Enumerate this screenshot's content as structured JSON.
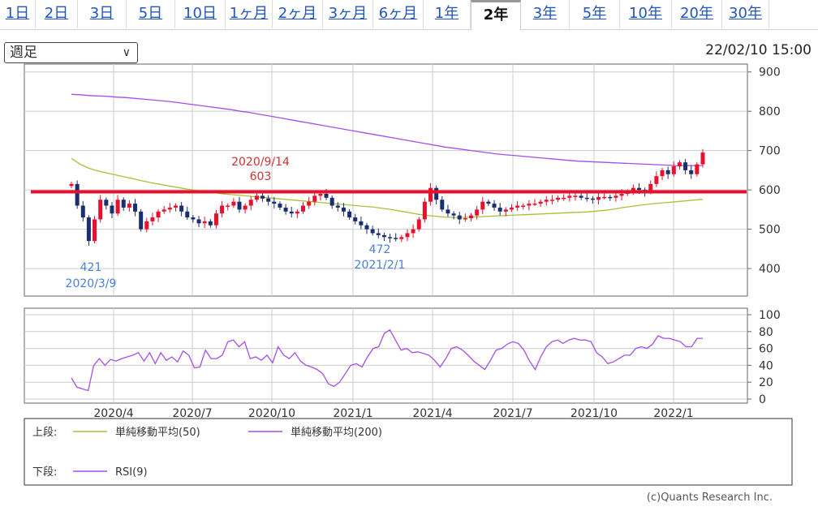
{
  "tabs": [
    "1日",
    "2日",
    "3日",
    "5日",
    "10日",
    "1ヶ月",
    "2ヶ月",
    "3ヶ月",
    "6ヶ月",
    "1年",
    "2年",
    "3年",
    "5年",
    "10年",
    "20年",
    "30年"
  ],
  "active_tab": "2年",
  "period_select": {
    "value": "週足"
  },
  "timestamp": "22/02/10 15:00",
  "copyright": "(c)Quants Research Inc.",
  "legend": {
    "upper_label": "上段:",
    "lower_label": "下段:",
    "sma50": "単純移動平均(50)",
    "sma200": "単純移動平均(200)",
    "rsi": "RSI(9)"
  },
  "colors": {
    "up": "#e8112d",
    "down": "#1a2f6e",
    "sma50": "#a6c338",
    "sma200": "#a64ee8",
    "rsi": "#a64ee8",
    "hline": "#e8112d"
  },
  "chart_data": [
    {
      "type": "candlestick",
      "x_tick_labels": [
        "2020/4",
        "2020/7",
        "2020/10",
        "2021/1",
        "2021/4",
        "2021/7",
        "2021/10",
        "2022/1"
      ],
      "y_ticks": [
        400,
        500,
        600,
        700,
        800,
        900
      ],
      "ylim": [
        330,
        920
      ],
      "horizontal_line": 595,
      "annotations": [
        {
          "date": "2020/9/14",
          "value": "603",
          "color": "red",
          "label_date": "2020/9/14",
          "label_value": "603"
        },
        {
          "date": "2020/3/9",
          "value": "421",
          "color": "blue",
          "label_date": "2020/3/9",
          "label_value": "421"
        },
        {
          "date": "2021/2/1",
          "value": "472",
          "color": "blue",
          "label_date": "2021/2/1",
          "label_value": "472"
        }
      ],
      "close": [
        615,
        560,
        530,
        470,
        525,
        575,
        560,
        540,
        575,
        555,
        565,
        545,
        500,
        520,
        530,
        545,
        550,
        555,
        560,
        545,
        530,
        525,
        515,
        520,
        510,
        540,
        560,
        560,
        570,
        550,
        560,
        575,
        585,
        578,
        570,
        565,
        555,
        545,
        540,
        545,
        560,
        570,
        585,
        590,
        580,
        560,
        555,
        545,
        530,
        520,
        510,
        500,
        490,
        485,
        480,
        478,
        475,
        480,
        490,
        500,
        525,
        570,
        605,
        575,
        550,
        540,
        535,
        525,
        528,
        535,
        550,
        570,
        565,
        555,
        545,
        550,
        555,
        560,
        560,
        565,
        565,
        570,
        575,
        575,
        580,
        580,
        585,
        585,
        580,
        578,
        575,
        582,
        582,
        580,
        585,
        590,
        595,
        605,
        600,
        595,
        615,
        635,
        650,
        640,
        660,
        670,
        650,
        640,
        665,
        695
      ],
      "sma50": [
        680,
        665,
        655,
        648,
        643,
        638,
        633,
        628,
        623,
        618,
        614,
        610,
        606,
        602,
        599,
        596,
        593,
        590,
        588,
        586,
        584,
        582,
        580,
        578,
        576,
        574,
        572,
        570,
        568,
        566,
        564,
        562,
        560,
        558,
        556,
        553,
        550,
        546,
        542,
        538,
        535,
        533,
        531,
        530,
        530,
        531,
        532,
        533,
        534,
        535,
        536,
        537,
        538,
        539,
        540,
        541,
        542,
        543,
        544,
        546,
        548,
        551,
        555,
        558,
        561,
        564,
        566,
        568,
        570,
        572,
        574,
        576
      ],
      "sma200": [
        843,
        842,
        840,
        839,
        838,
        836,
        835,
        833,
        831,
        829,
        827,
        825,
        822,
        819,
        816,
        813,
        810,
        807,
        804,
        800,
        797,
        793,
        789,
        785,
        781,
        777,
        773,
        769,
        765,
        761,
        757,
        753,
        749,
        745,
        741,
        737,
        733,
        729,
        725,
        721,
        717,
        713,
        709,
        706,
        703,
        700,
        697,
        694,
        691,
        689,
        687,
        685,
        683,
        681,
        679,
        677,
        675,
        673,
        672,
        671,
        670,
        669,
        668,
        667,
        666,
        665,
        664,
        663,
        662,
        662,
        662,
        662
      ]
    },
    {
      "type": "line",
      "name": "RSI(9)",
      "y_ticks": [
        0,
        20,
        40,
        60,
        80,
        100
      ],
      "ylim": [
        0,
        100
      ],
      "values": [
        25,
        14,
        12,
        10,
        40,
        48,
        40,
        47,
        45,
        48,
        50,
        52,
        55,
        45,
        55,
        42,
        55,
        46,
        50,
        44,
        57,
        52,
        37,
        38,
        58,
        48,
        48,
        52,
        68,
        70,
        62,
        68,
        48,
        50,
        46,
        52,
        43,
        62,
        52,
        48,
        55,
        45,
        40,
        38,
        35,
        30,
        18,
        15,
        20,
        30,
        40,
        42,
        38,
        50,
        60,
        62,
        78,
        82,
        70,
        58,
        60,
        55,
        56,
        54,
        52,
        46,
        38,
        48,
        60,
        62,
        58,
        52,
        45,
        40,
        35,
        46,
        58,
        60,
        65,
        68,
        66,
        58,
        45,
        35,
        50,
        62,
        68,
        70,
        66,
        70,
        72,
        70,
        70,
        68,
        55,
        50,
        42,
        44,
        48,
        52,
        52,
        60,
        62,
        60,
        65,
        75,
        72,
        72,
        70,
        68,
        62,
        62,
        72,
        72
      ]
    }
  ]
}
